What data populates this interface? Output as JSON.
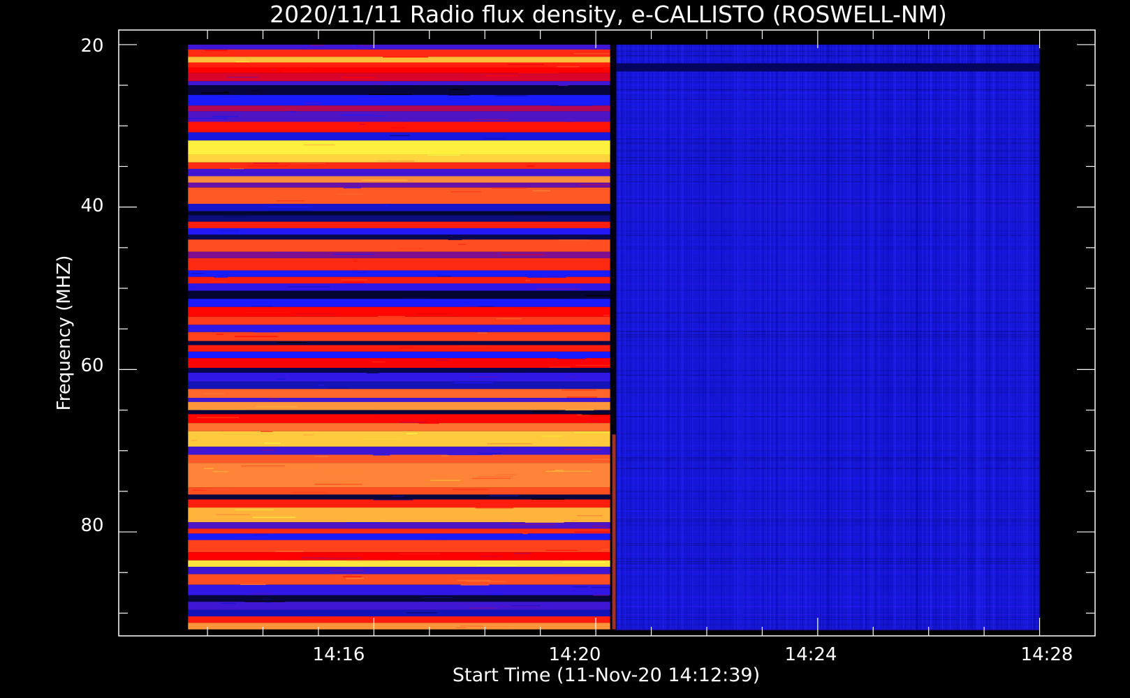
{
  "chart_data": {
    "type": "heatmap",
    "title": "2020/11/11  Radio flux density, e-CALLISTO (ROSWELL-NM)",
    "xlabel": "Start Time (11-Nov-20 14:12:39)",
    "ylabel": "Frequency (MHZ)",
    "x_ticks": [
      "14:16",
      "14:20",
      "14:24",
      "14:28"
    ],
    "y_ticks": [
      "20",
      "40",
      "60",
      "80"
    ],
    "xlim_minutes_after_14_00": [
      11.4,
      29.0
    ],
    "x_data_range": [
      "14:12:39",
      "14:28:00"
    ],
    "ylim_mhz": [
      18.2,
      92.8
    ],
    "y_data_range_mhz": [
      20,
      92
    ],
    "y_axis": "inverted (low frequency at top)",
    "transition_time": "14:20:17",
    "colormap": [
      "#000000",
      "#1a1aff",
      "#ff0000",
      "#ff8a3a",
      "#ffff40"
    ],
    "intensity_profile": [
      {
        "mhz": [
          20.0,
          20.6
        ],
        "i": 0.3
      },
      {
        "mhz": [
          20.6,
          21.5
        ],
        "i": 0.62
      },
      {
        "mhz": [
          21.5,
          22.2
        ],
        "i": 0.88
      },
      {
        "mhz": [
          22.2,
          22.8
        ],
        "i": 0.6
      },
      {
        "mhz": [
          22.8,
          23.5
        ],
        "i": 0.55
      },
      {
        "mhz": [
          23.5,
          24.5
        ],
        "i": 0.5
      },
      {
        "mhz": [
          24.5,
          25.0
        ],
        "i": 0.3
      },
      {
        "mhz": [
          25.0,
          26.2
        ],
        "i": 0.06
      },
      {
        "mhz": [
          26.2,
          27.5
        ],
        "i": 0.25
      },
      {
        "mhz": [
          27.5,
          28.2
        ],
        "i": 0.45
      },
      {
        "mhz": [
          28.2,
          29.5
        ],
        "i": 0.32
      },
      {
        "mhz": [
          29.5,
          30.8
        ],
        "i": 0.58
      },
      {
        "mhz": [
          30.8,
          31.8
        ],
        "i": 0.22
      },
      {
        "mhz": [
          31.8,
          33.5
        ],
        "i": 0.97
      },
      {
        "mhz": [
          33.5,
          34.5
        ],
        "i": 0.92
      },
      {
        "mhz": [
          34.5,
          35.3
        ],
        "i": 0.62
      },
      {
        "mhz": [
          35.3,
          36.2
        ],
        "i": 0.3
      },
      {
        "mhz": [
          36.2,
          37.0
        ],
        "i": 0.78
      },
      {
        "mhz": [
          37.0,
          37.6
        ],
        "i": 0.35
      },
      {
        "mhz": [
          37.6,
          39.6
        ],
        "i": 0.7
      },
      {
        "mhz": [
          39.6,
          40.5
        ],
        "i": 0.2
      },
      {
        "mhz": [
          40.5,
          41.0
        ],
        "i": 0.05
      },
      {
        "mhz": [
          41.0,
          41.8
        ],
        "i": 0.12
      },
      {
        "mhz": [
          41.8,
          42.6
        ],
        "i": 0.6
      },
      {
        "mhz": [
          42.6,
          43.4
        ],
        "i": 0.26
      },
      {
        "mhz": [
          43.4,
          44.0
        ],
        "i": 0.08
      },
      {
        "mhz": [
          44.0,
          45.5
        ],
        "i": 0.68
      },
      {
        "mhz": [
          45.5,
          46.3
        ],
        "i": 0.38
      },
      {
        "mhz": [
          46.3,
          47.8
        ],
        "i": 0.62
      },
      {
        "mhz": [
          47.8,
          48.6
        ],
        "i": 0.25
      },
      {
        "mhz": [
          48.6,
          49.4
        ],
        "i": 0.6
      },
      {
        "mhz": [
          49.4,
          50.3
        ],
        "i": 0.28
      },
      {
        "mhz": [
          50.3,
          51.3
        ],
        "i": 0.05
      },
      {
        "mhz": [
          51.3,
          52.3
        ],
        "i": 0.25
      },
      {
        "mhz": [
          52.3,
          53.5
        ],
        "i": 0.56
      },
      {
        "mhz": [
          53.5,
          54.5
        ],
        "i": 0.65
      },
      {
        "mhz": [
          54.5,
          55.4
        ],
        "i": 0.28
      },
      {
        "mhz": [
          55.4,
          56.5
        ],
        "i": 0.66
      },
      {
        "mhz": [
          56.5,
          57.0
        ],
        "i": 0.07
      },
      {
        "mhz": [
          57.0,
          57.8
        ],
        "i": 0.6
      },
      {
        "mhz": [
          57.8,
          58.6
        ],
        "i": 0.25
      },
      {
        "mhz": [
          58.6,
          59.8
        ],
        "i": 0.55
      },
      {
        "mhz": [
          59.8,
          60.4
        ],
        "i": 0.08
      },
      {
        "mhz": [
          60.4,
          61.5
        ],
        "i": 0.28
      },
      {
        "mhz": [
          61.5,
          62.4
        ],
        "i": 0.18
      },
      {
        "mhz": [
          62.4,
          63.5
        ],
        "i": 0.72
      },
      {
        "mhz": [
          63.5,
          64.0
        ],
        "i": 0.3
      },
      {
        "mhz": [
          64.0,
          65.0
        ],
        "i": 0.8
      },
      {
        "mhz": [
          65.0,
          65.5
        ],
        "i": 0.06
      },
      {
        "mhz": [
          65.5,
          66.6
        ],
        "i": 0.56
      },
      {
        "mhz": [
          66.6,
          67.6
        ],
        "i": 0.74
      },
      {
        "mhz": [
          67.6,
          69.5
        ],
        "i": 0.9
      },
      {
        "mhz": [
          69.5,
          70.5
        ],
        "i": 0.3
      },
      {
        "mhz": [
          70.5,
          71.5
        ],
        "i": 0.7
      },
      {
        "mhz": [
          71.5,
          74.5
        ],
        "i": 0.77
      },
      {
        "mhz": [
          74.5,
          75.4
        ],
        "i": 0.68
      },
      {
        "mhz": [
          75.4,
          76.0
        ],
        "i": 0.06
      },
      {
        "mhz": [
          76.0,
          77.0
        ],
        "i": 0.6
      },
      {
        "mhz": [
          77.0,
          78.8
        ],
        "i": 0.86
      },
      {
        "mhz": [
          78.8,
          79.6
        ],
        "i": 0.32
      },
      {
        "mhz": [
          79.6,
          80.2
        ],
        "i": 0.62
      },
      {
        "mhz": [
          80.2,
          81.0
        ],
        "i": 0.25
      },
      {
        "mhz": [
          81.0,
          82.5
        ],
        "i": 0.66
      },
      {
        "mhz": [
          82.5,
          83.5
        ],
        "i": 0.55
      },
      {
        "mhz": [
          83.5,
          84.3
        ],
        "i": 0.95
      },
      {
        "mhz": [
          84.3,
          85.2
        ],
        "i": 0.3
      },
      {
        "mhz": [
          85.2,
          86.5
        ],
        "i": 0.68
      },
      {
        "mhz": [
          86.5,
          87.8
        ],
        "i": 0.28
      },
      {
        "mhz": [
          87.8,
          88.6
        ],
        "i": 0.06
      },
      {
        "mhz": [
          88.6,
          89.6
        ],
        "i": 0.3
      },
      {
        "mhz": [
          89.6,
          90.4
        ],
        "i": 0.18
      },
      {
        "mhz": [
          90.4,
          91.2
        ],
        "i": 0.6
      },
      {
        "mhz": [
          91.2,
          92.0
        ],
        "i": 0.8
      }
    ]
  }
}
